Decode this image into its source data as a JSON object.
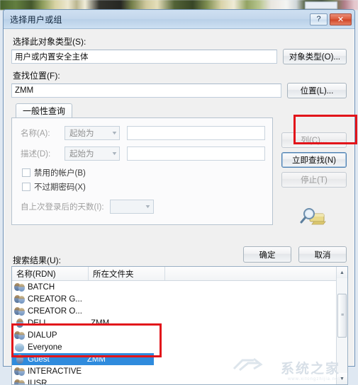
{
  "window": {
    "title": "选择用户或组",
    "help_button": "?",
    "close_button": "✕"
  },
  "object_type": {
    "label": "选择此对象类型(S):",
    "value": "用户或内置安全主体",
    "button": "对象类型(O)..."
  },
  "location": {
    "label": "查找位置(F):",
    "value": "ZMM",
    "button": "位置(L)..."
  },
  "tabs": [
    {
      "label": "一般性查询",
      "active": true
    }
  ],
  "query": {
    "name": {
      "label": "名称(A):",
      "operator": "起始为",
      "value": "",
      "arrow": "▼"
    },
    "description": {
      "label": "描述(D):",
      "operator": "起始为",
      "value": "",
      "arrow": "▼"
    },
    "disabled_accounts": {
      "label": "禁用的帐户(B)",
      "checked": false
    },
    "non_expiring_password": {
      "label": "不过期密码(X)",
      "checked": false
    },
    "days_since_logon": {
      "label": "自上次登录后的天数(I):",
      "value": "",
      "arrow": "▼"
    }
  },
  "side_buttons": {
    "columns": "列(C)...",
    "find_now": "立即查找(N)",
    "stop": "停止(T)"
  },
  "dialog_buttons": {
    "ok": "确定",
    "cancel": "取消"
  },
  "results": {
    "label": "搜索结果(U):",
    "columns": [
      "名称(RDN)",
      "所在文件夹"
    ],
    "rows": [
      {
        "name": "BATCH",
        "folder": "",
        "icon": "group-icon",
        "selected": false
      },
      {
        "name": "CREATOR G...",
        "folder": "",
        "icon": "group-icon",
        "selected": false
      },
      {
        "name": "CREATOR O...",
        "folder": "",
        "icon": "group-icon",
        "selected": false
      },
      {
        "name": "DELL",
        "folder": "ZMM",
        "icon": "user-icon",
        "selected": false
      },
      {
        "name": "DIALUP",
        "folder": "",
        "icon": "group-icon",
        "selected": false
      },
      {
        "name": "Everyone",
        "folder": "",
        "icon": "everyone-icon",
        "selected": false
      },
      {
        "name": "Guest",
        "folder": "ZMM",
        "icon": "user-icon",
        "selected": true
      },
      {
        "name": "INTERACTIVE",
        "folder": "",
        "icon": "group-icon",
        "selected": false
      },
      {
        "name": "IUSR",
        "folder": "",
        "icon": "group-icon",
        "selected": false
      }
    ],
    "scroll_up": "▲",
    "scroll_down": "▼",
    "thumb_grip": "≡"
  },
  "watermark": {
    "text": "系统之家",
    "subtext": "www.xitongzhijia.net"
  },
  "colors": {
    "selection_blue": "#2f8bdd",
    "annotation_red": "#e2141a",
    "title_bar": "#c3d7ec",
    "close_button": "#cf4426"
  }
}
